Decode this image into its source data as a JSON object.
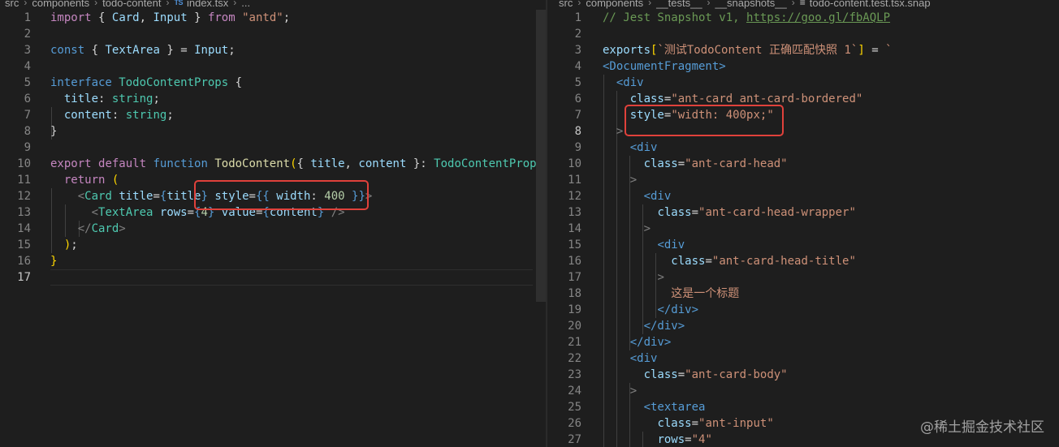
{
  "left": {
    "breadcrumb": {
      "items": [
        "src",
        "components",
        "todo-content"
      ],
      "file_icon": "TS",
      "file": "index.tsx",
      "ellipsis": "..."
    }
  },
  "right": {
    "breadcrumb": {
      "items": [
        "src",
        "components",
        "__tests__",
        "__snapshots__"
      ],
      "file_icon": "≡",
      "file": "todo-content.test.tsx.snap"
    }
  },
  "editor_lines": {
    "left_numbers": [
      "1",
      "2",
      "3",
      "4",
      "5",
      "6",
      "7",
      "8",
      "9",
      "10",
      "11",
      "12",
      "13",
      "14",
      "15",
      "16",
      "17"
    ],
    "right_numbers": [
      "1",
      "2",
      "3",
      "4",
      "5",
      "6",
      "7",
      "8",
      "9",
      "10",
      "11",
      "12",
      "13",
      "14",
      "15",
      "16",
      "17",
      "18",
      "19",
      "20",
      "21",
      "22",
      "23",
      "24",
      "25",
      "26",
      "27"
    ]
  },
  "code": {
    "l1": {
      "import": "import",
      "lb": "{",
      "card": "Card",
      "comma": ",",
      "input": "Input",
      "rb": "}",
      "from": "from",
      "module": "\"antd\"",
      "semi": ";"
    },
    "l3": {
      "const": "const",
      "lb": "{",
      "textarea": "TextArea",
      "rb": "}",
      "eq": "=",
      "input": "Input",
      "semi": ";"
    },
    "l5": {
      "interface": "interface",
      "name": "TodoContentProps",
      "lb": "{"
    },
    "l6": {
      "prop": "title",
      "colon": ":",
      "type": "string",
      "semi": ";"
    },
    "l7": {
      "prop": "content",
      "colon": ":",
      "type": "string",
      "semi": ";"
    },
    "l8": {
      "rb": "}"
    },
    "l10": {
      "export": "export",
      "default": "default",
      "function": "function",
      "name": "TodoContent",
      "lp": "(",
      "lb": "{",
      "p1": "title",
      "comma": ",",
      "p2": "content",
      "rb": "}",
      "colon": ":",
      "type": "TodoContentProps",
      "rp": ")",
      "lb2": "{"
    },
    "l11": {
      "return": "return",
      "lp": "("
    },
    "l12": {
      "lt": "<",
      "tag": "Card",
      "attr1": "title",
      "eq1": "=",
      "lb1": "{",
      "val1": "title",
      "rb1": "}",
      "attr2": "style",
      "eq2": "=",
      "lb2": "{{",
      "key": "width",
      "colon": ":",
      "num": "400",
      "rb2": "}}",
      "gt": ">"
    },
    "l13": {
      "lt": "<",
      "tag": "TextArea",
      "attr1": "rows",
      "eq1": "=",
      "lb1": "{",
      "num": "4",
      "rb1": "}",
      "attr2": "value",
      "eq2": "=",
      "lb2": "{",
      "val2": "content",
      "rb2": "}",
      "close": "/>"
    },
    "l14": {
      "open": "</",
      "tag": "Card",
      "gt": ">"
    },
    "l15": {
      "rp": ")",
      "semi": ";"
    },
    "l16": {
      "rb": "}"
    },
    "r1": {
      "comment": "// Jest Snapshot v1,",
      "url": "https://goo.gl/fbAQLP"
    },
    "r3": {
      "exports": "exports",
      "lbr": "[",
      "key": "`测试TodoContent 正确匹配快照 1`",
      "rbr": "]",
      "eq": "=",
      "tick": "`"
    },
    "r4": {
      "tag": "<DocumentFragment>"
    },
    "r5": {
      "tag": "<div"
    },
    "r6": {
      "attr": "class",
      "eq": "=",
      "val": "\"ant-card ant-card-bordered\""
    },
    "r7": {
      "attr": "style",
      "eq": "=",
      "val": "\"width: 400px;\""
    },
    "r8": {
      "gt": ">"
    },
    "r9": {
      "tag": "<div"
    },
    "r10": {
      "attr": "class",
      "eq": "=",
      "val": "\"ant-card-head\""
    },
    "r11": {
      "gt": ">"
    },
    "r12": {
      "tag": "<div"
    },
    "r13": {
      "attr": "class",
      "eq": "=",
      "val": "\"ant-card-head-wrapper\""
    },
    "r14": {
      "gt": ">"
    },
    "r15": {
      "tag": "<div"
    },
    "r16": {
      "attr": "class",
      "eq": "=",
      "val": "\"ant-card-head-title\""
    },
    "r17": {
      "gt": ">"
    },
    "r18": {
      "text": "这是一个标题"
    },
    "r19": {
      "tag": "</div>"
    },
    "r20": {
      "tag": "</div>"
    },
    "r21": {
      "tag": "</div>"
    },
    "r22": {
      "tag": "<div"
    },
    "r23": {
      "attr": "class",
      "eq": "=",
      "val": "\"ant-card-body\""
    },
    "r24": {
      "gt": ">"
    },
    "r25": {
      "tag": "<textarea"
    },
    "r26": {
      "attr": "class",
      "eq": "=",
      "val": "\"ant-input\""
    },
    "r27": {
      "attr": "rows",
      "eq": "=",
      "val": "\"4\""
    }
  },
  "watermark": "@稀土掘金技术社区",
  "colors": {
    "highlight_box": "#e0413b",
    "background": "#1e1e1e"
  }
}
